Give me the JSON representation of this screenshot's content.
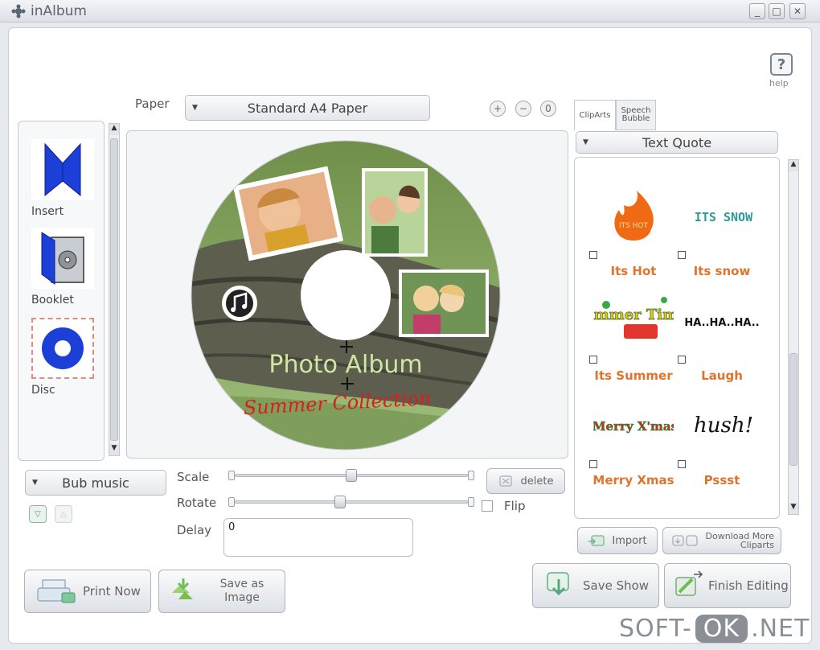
{
  "window": {
    "title": "inAlbum"
  },
  "help": {
    "icon": "?",
    "label": "help"
  },
  "paper": {
    "label": "Paper",
    "value": "Standard A4 Paper"
  },
  "zoom": {
    "in": "+",
    "out": "−",
    "reset": "0"
  },
  "sidebar": {
    "items": [
      {
        "label": "Insert"
      },
      {
        "label": "Booklet"
      },
      {
        "label": "Disc"
      }
    ]
  },
  "disc": {
    "title": "Photo Album",
    "subtitle": "Summer Collection"
  },
  "music": {
    "value": "Bub music"
  },
  "controls": {
    "scale_label": "Scale",
    "rotate_label": "Rotate",
    "delay_label": "Delay",
    "delay_value": "0",
    "scale_level": 0.5,
    "rotate_level": 0.45,
    "delete_label": "delete",
    "flip_label": "Flip"
  },
  "tabs": [
    {
      "label": "ClipArts"
    },
    {
      "label": "Speech Bubble"
    }
  ],
  "clip_category": "Text Quote",
  "cliparts": [
    {
      "name": "Its Hot",
      "art": "ITS HOT"
    },
    {
      "name": "Its snow",
      "art": "ITS SNOW"
    },
    {
      "name": "Its Summer",
      "art": "Summer Time ?"
    },
    {
      "name": "Laugh",
      "art": "HA..HA..HA.."
    },
    {
      "name": "Merry Xmas",
      "art": "Merry X'mas"
    },
    {
      "name": "Pssst",
      "art": "hush!"
    }
  ],
  "buttons": {
    "import": "Import",
    "download": "Download More Cliparts",
    "print_now": "Print Now",
    "save_as_image": "Save as Image",
    "save_show": "Save Show",
    "finish_editing": "Finish Editing"
  },
  "watermark": {
    "left": "SOFT-",
    "box": "OK",
    "right": ".NET"
  }
}
